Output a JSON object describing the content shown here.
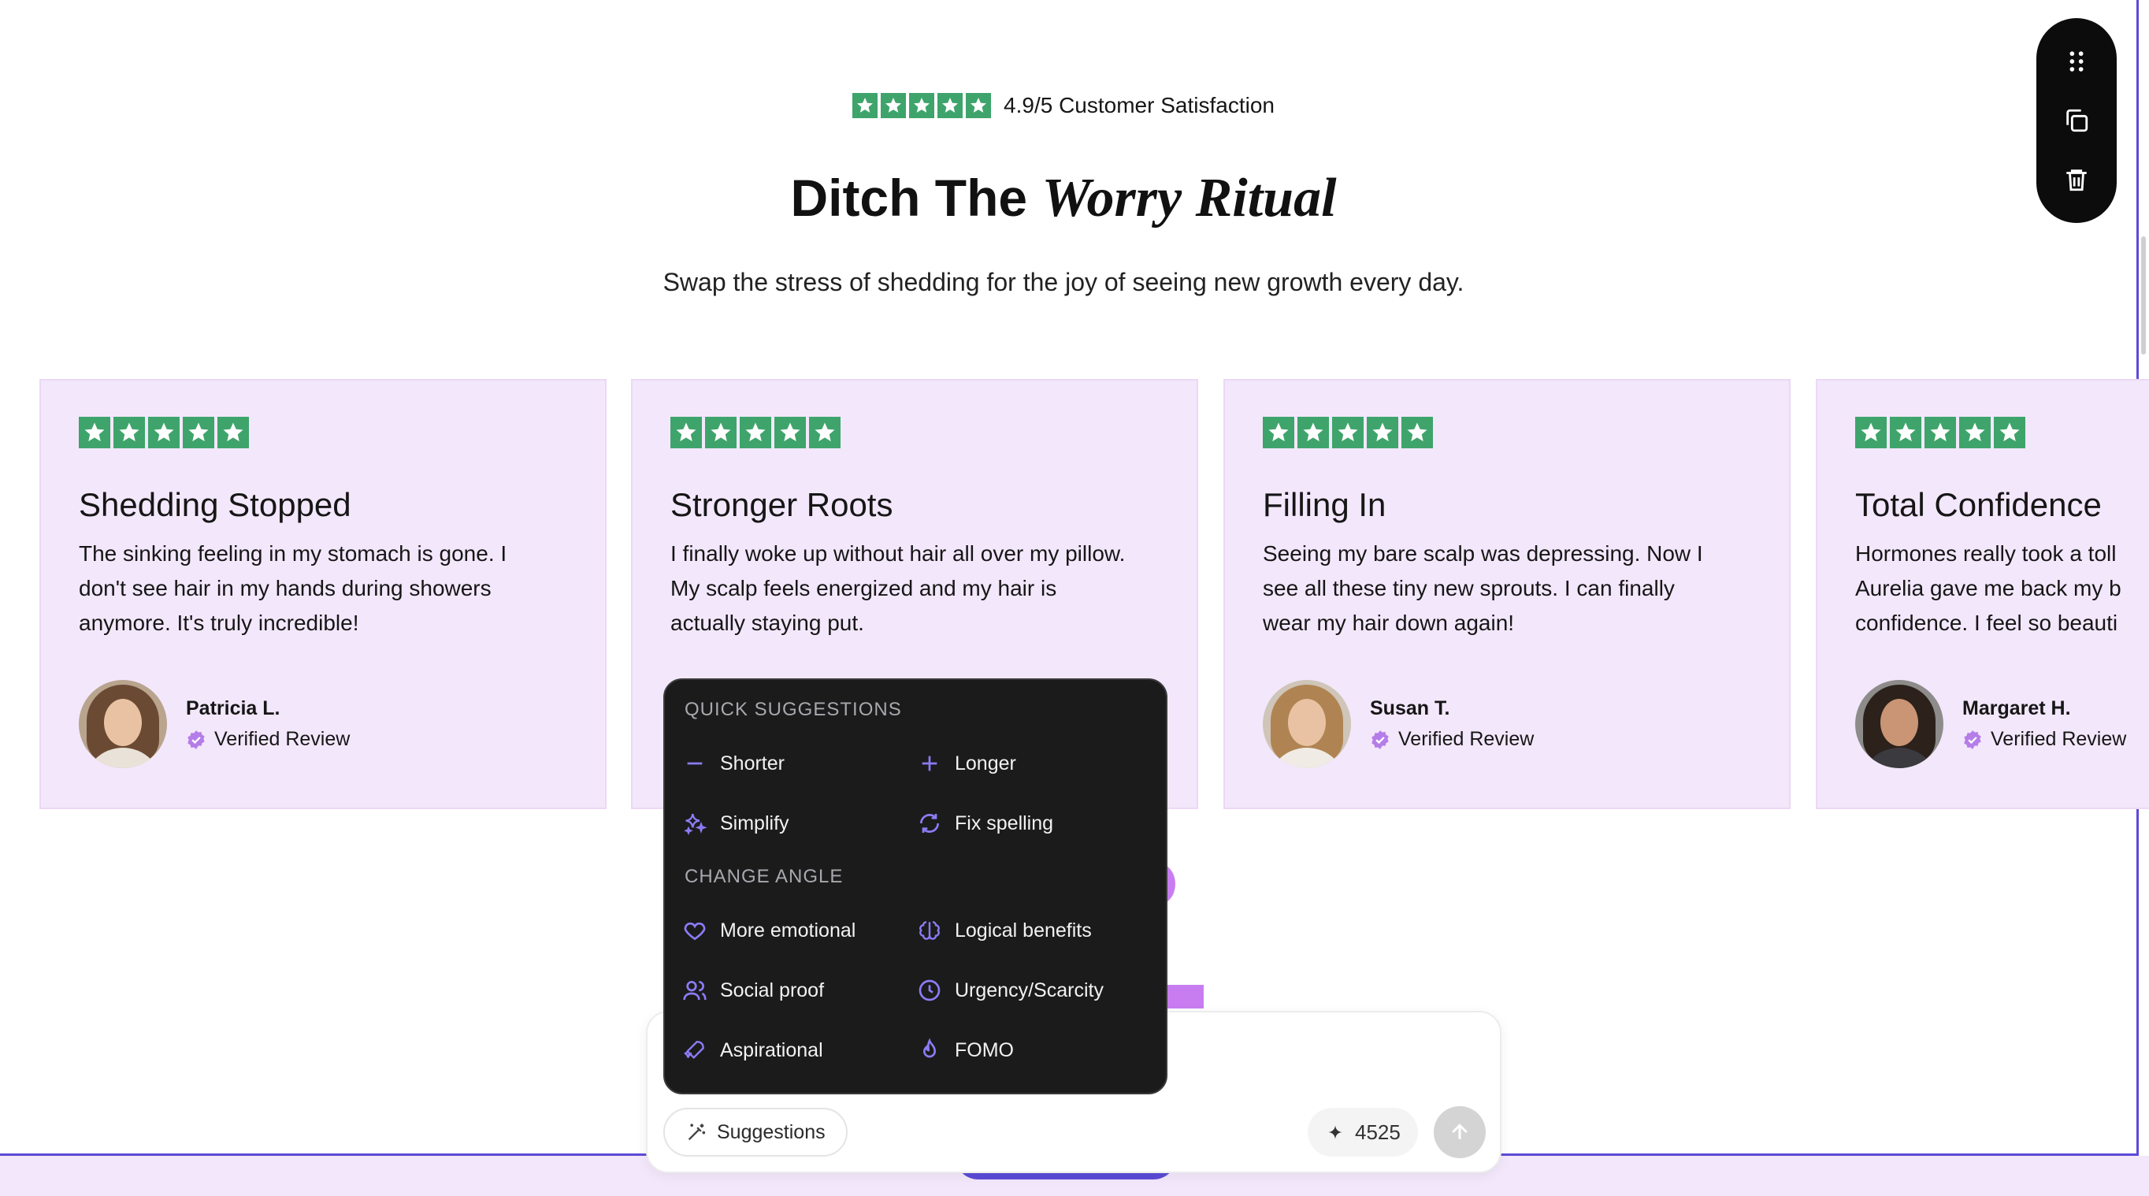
{
  "header": {
    "rating_text": "4.9/5 Customer Satisfaction",
    "heading_plain": "Ditch The ",
    "heading_italic": "Worry Ritual",
    "subheading": "Swap the stress of shedding for the joy of seeing new growth every day."
  },
  "colors": {
    "star_green": "#3ea46b",
    "card_bg": "#f3e7fb",
    "accent_purple": "#5b4bd6",
    "badge_purple": "#b57de8",
    "popup_bg": "#1b1b1b"
  },
  "cards": [
    {
      "title": "Shedding Stopped",
      "body": [
        "The sinking feeling in my stomach is gone. I",
        "don't see hair in my hands during showers",
        "anymore. It's truly incredible!"
      ],
      "name": "Patricia L.",
      "verified": "Verified Review",
      "rating": 5
    },
    {
      "title": "Stronger Roots",
      "body": [
        "I finally woke up without hair all over my pillow.",
        "My scalp feels energized and my hair is",
        "actually staying put."
      ],
      "name": "",
      "verified": "",
      "rating": 5
    },
    {
      "title": "Filling In",
      "body": [
        "Seeing my bare scalp was depressing. Now I",
        "see all these tiny new sprouts. I can finally",
        "wear my hair down again!"
      ],
      "name": "Susan T.",
      "verified": "Verified Review",
      "rating": 5
    },
    {
      "title": "Total Confidence",
      "body": [
        "Hormones really took a toll",
        "Aurelia gave me back my b",
        "confidence. I feel so beauti"
      ],
      "name": "Margaret H.",
      "verified": "Verified Review",
      "rating": 5
    }
  ],
  "toolbar": {
    "icons": [
      "drag-handle-icon",
      "duplicate-icon",
      "trash-icon"
    ]
  },
  "popup": {
    "quick_title": "QUICK SUGGESTIONS",
    "angle_title": "CHANGE ANGLE",
    "quick": [
      {
        "label": "Shorter",
        "icon": "minus-icon"
      },
      {
        "label": "Longer",
        "icon": "plus-icon"
      },
      {
        "label": "Simplify",
        "icon": "sparkles-icon"
      },
      {
        "label": "Fix spelling",
        "icon": "refresh-icon"
      }
    ],
    "angles": [
      {
        "label": "More emotional",
        "icon": "heart-icon"
      },
      {
        "label": "Logical benefits",
        "icon": "brain-icon"
      },
      {
        "label": "Social proof",
        "icon": "users-icon"
      },
      {
        "label": "Urgency/Scarcity",
        "icon": "clock-icon"
      },
      {
        "label": "Aspirational",
        "icon": "rocket-icon"
      },
      {
        "label": "FOMO",
        "icon": "flame-icon"
      }
    ]
  },
  "chat": {
    "suggestions_label": "Suggestions",
    "credits": "4525"
  }
}
